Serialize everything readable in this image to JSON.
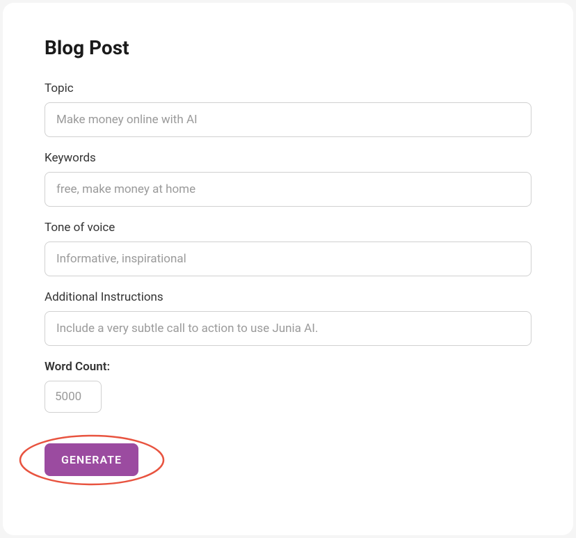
{
  "title": "Blog Post",
  "form": {
    "topic": {
      "label": "Topic",
      "placeholder": "Make money online with AI",
      "value": ""
    },
    "keywords": {
      "label": "Keywords",
      "placeholder": "free, make money at home",
      "value": ""
    },
    "tone": {
      "label": "Tone of voice",
      "placeholder": "Informative, inspirational",
      "value": ""
    },
    "instructions": {
      "label": "Additional Instructions",
      "placeholder": "Include a very subtle call to action to use Junia AI.",
      "value": ""
    },
    "wordCount": {
      "label": "Word Count:",
      "placeholder": "5000",
      "value": ""
    }
  },
  "actions": {
    "generate": "GENERATE"
  }
}
